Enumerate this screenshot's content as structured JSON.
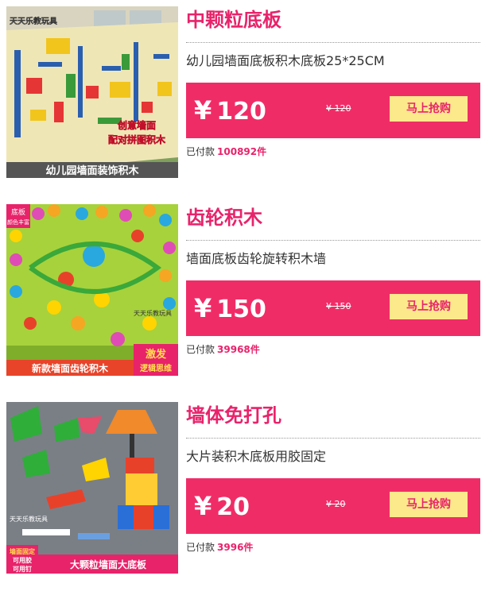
{
  "products": [
    {
      "title": "中颗粒底板",
      "description": "幼儿园墙面底板积木底板25*25CM",
      "currency": "¥",
      "price": "120",
      "original_price": "¥ 120",
      "buy_label": "马上抢购",
      "sold_label": "已付款",
      "sold_count": "100892件",
      "image": {
        "brand": "天天乐教玩具",
        "caption": "幼儿园墙面装饰积木",
        "tag_lines": [
          "创意墙面",
          "配对拼图积木"
        ]
      }
    },
    {
      "title": "齿轮积木",
      "description": "墙面底板齿轮旋转积木墙",
      "currency": "¥",
      "price": "150",
      "original_price": "¥ 150",
      "buy_label": "马上抢购",
      "sold_label": "已付款",
      "sold_count": "39968件",
      "image": {
        "brand": "天天乐教玩具",
        "caption": "新款墙面齿轮积木",
        "corner_lines": [
          "底板",
          "颜色丰富"
        ],
        "badge_lines": [
          "激发",
          "逻辑思维"
        ]
      }
    },
    {
      "title": "墙体免打孔",
      "description": "大片装积木底板用胶固定",
      "currency": "¥",
      "price": "20",
      "original_price": "¥ 20",
      "buy_label": "马上抢购",
      "sold_label": "已付款",
      "sold_count": "3996件",
      "image": {
        "brand": "天天乐教玩具",
        "caption": "大颗粒墙面大底板",
        "corner_lines": [
          "墙面固定",
          "可用胶",
          "可用钉"
        ]
      }
    }
  ],
  "colors": {
    "accent": "#e8236a",
    "price_bar": "#f02c67",
    "buy_button": "#fce98c"
  }
}
